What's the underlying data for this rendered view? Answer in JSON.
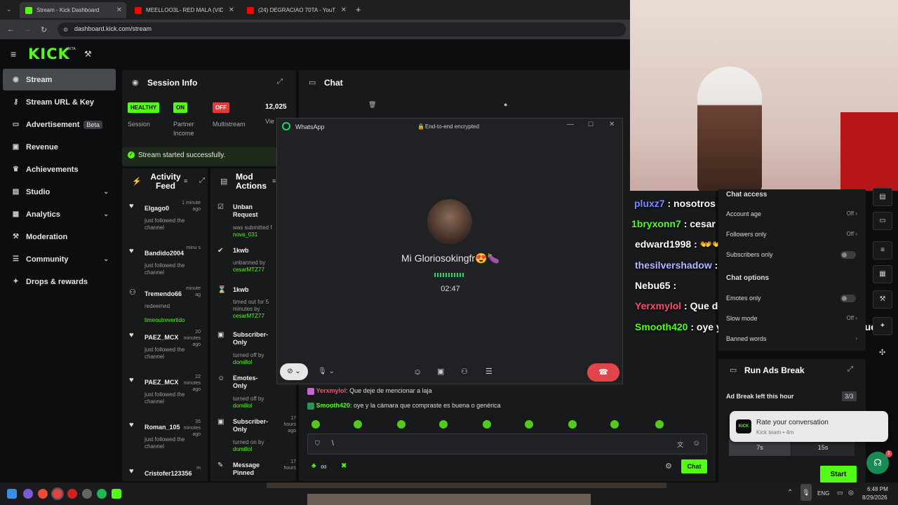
{
  "browser": {
    "tabs": [
      {
        "title": "Stream - Kick Dashboard",
        "color": "#53fc18"
      },
      {
        "title": "MEELLOO3L- RED MALA (VIDEO",
        "color": "#ff0000"
      },
      {
        "title": "(24) DEGRACIAO 70TA - YouTub",
        "color": "#ff0000"
      }
    ],
    "url": "dashboard.kick.com/stream",
    "new_tab": "+"
  },
  "kick": {
    "logo": "KICK",
    "beta": "BETA"
  },
  "sidebar": {
    "items": [
      {
        "label": "Stream",
        "icon": "broadcast-icon"
      },
      {
        "label": "Stream URL & Key",
        "icon": "key-icon"
      },
      {
        "label": "Advertisement",
        "badge": "Beta",
        "icon": "monitor-icon"
      },
      {
        "label": "Revenue",
        "icon": "wallet-icon"
      },
      {
        "label": "Achievements",
        "icon": "trophy-icon"
      },
      {
        "label": "Studio",
        "icon": "studio-icon"
      },
      {
        "label": "Analytics",
        "icon": "analytics-icon"
      },
      {
        "label": "Moderation",
        "icon": "hammer-icon"
      },
      {
        "label": "Community",
        "icon": "community-icon"
      },
      {
        "label": "Drops & rewards",
        "icon": "gift-icon"
      }
    ]
  },
  "session": {
    "title": "Session Info",
    "stats": [
      {
        "badge": "HEALTHY",
        "label": "Session",
        "color": "#53fc18"
      },
      {
        "badge": "ON",
        "label": "Partner Income",
        "color": "#53fc18"
      },
      {
        "badge": "OFF",
        "label": "Multistream",
        "color": "#e03a3a"
      },
      {
        "badge": "12,025",
        "label": "Vie"
      }
    ],
    "success": "Stream started successfully."
  },
  "activity": {
    "title": "Activity Feed",
    "items": [
      {
        "name": "Elgago0",
        "time": "1 minute ago",
        "desc": "just followed the channel",
        "extra": ""
      },
      {
        "name": "Bandido2004",
        "time": "minu s",
        "desc": "just followed the channel",
        "extra": ""
      },
      {
        "name": "Tremendo66",
        "time": "minute ag",
        "desc": "redeemed",
        "extra": "timeoutrevertido"
      },
      {
        "name": "PAEZ_MCX",
        "time": "20 minutes ago",
        "desc": "just followed the channel",
        "extra": ""
      },
      {
        "name": "PAEZ_MCX",
        "time": "22 minutes ago",
        "desc": "just followed the channel",
        "extra": ""
      },
      {
        "name": "Roman_105",
        "time": "35 minutes ago",
        "desc": "just followed the channel",
        "extra": ""
      },
      {
        "name": "Cristofer123356",
        "time": "m",
        "desc": "",
        "extra": ""
      }
    ]
  },
  "modactions": {
    "title": "Mod Actions",
    "items": [
      {
        "name": "Unban Request",
        "time": "sec",
        "desc": "was submitted f",
        "extra": "nova_031"
      },
      {
        "name": "1kwb",
        "time": "44 min",
        "desc": "unbanned by",
        "extra": "cesarMTZ77"
      },
      {
        "name": "1kwb",
        "time": "46 min",
        "desc": "timed out for 5 minutes by",
        "extra": "cesarMTZ77"
      },
      {
        "name": "Subscriber-Only",
        "time": "",
        "desc": "turned off by",
        "extra": "domillol"
      },
      {
        "name": "Emotes-Only",
        "time": "17 h",
        "desc": "turned off by",
        "extra": "domillol"
      },
      {
        "name": "Subscriber-Only",
        "time": "17 hours ago",
        "desc": "turned on by",
        "extra": "domillol"
      },
      {
        "name": "Message Pinned",
        "time": "17 hours",
        "desc": "",
        "extra": ""
      }
    ]
  },
  "chat": {
    "title": "Chat",
    "messages": [
      {
        "user": "Yerxmylol",
        "text": "Que deje de mencionar a laja"
      },
      {
        "user": "Smooth420",
        "text": "oye y la cámara que compraste es buena o genérica"
      }
    ],
    "input_value": "\\",
    "send_label": "Chat",
    "user_color": "#53fc18"
  },
  "whatsapp": {
    "app": "WhatsApp",
    "encrypted": "End-to-end encrypted",
    "caller": "Mi Gloriosokingfr😍🍆",
    "duration": "02:47"
  },
  "overlay_chat": [
    {
      "user": "pluxz7",
      "text": ": nosotros ?",
      "color": "#7b8cff"
    },
    {
      "user": "1bryxonn7",
      "text": ": cesar",
      "color": "#53fc18"
    },
    {
      "user": "edward1998",
      "text": ": 👐👐👐👐👐👐👐👐👐👐👐👐👐",
      "color": "#ffffff"
    },
    {
      "user": "thesilvershadow",
      "text": ":",
      "color": "#b3b8ff"
    },
    {
      "user": "Nebu65",
      "text": ":",
      "color": "#ffffff"
    },
    {
      "user": "Yerxmylol",
      "text": ": Que deje de mencionar a laja",
      "color": "#ff4d6a"
    },
    {
      "user": "Smooth420",
      "text": ": oye y la cámara que compraste es buen",
      "color": "#53fc18"
    }
  ],
  "settings": {
    "chat_access": "Chat access",
    "account_age": "Account age",
    "account_age_val": "Off",
    "followers_only": "Followers only",
    "followers_only_val": "Off",
    "subscribers_only": "Subscribers only",
    "chat_options": "Chat options",
    "emotes_only": "Emotes only",
    "slow_mode": "Slow mode",
    "slow_mode_val": "Off",
    "banned_words": "Banned words"
  },
  "ads": {
    "title": "Run Ads Break",
    "left_label": "Ad Break left this hour",
    "left_value": "3/3",
    "durations": [
      "7s",
      "15s"
    ],
    "start": "Start"
  },
  "toast": {
    "title": "Rate your conversation",
    "sub": "Kick team • 4m",
    "logo": "KICK"
  },
  "taskbar": {
    "lang": "ENG",
    "time": "6:48 PM",
    "date": "8/29/2026"
  }
}
